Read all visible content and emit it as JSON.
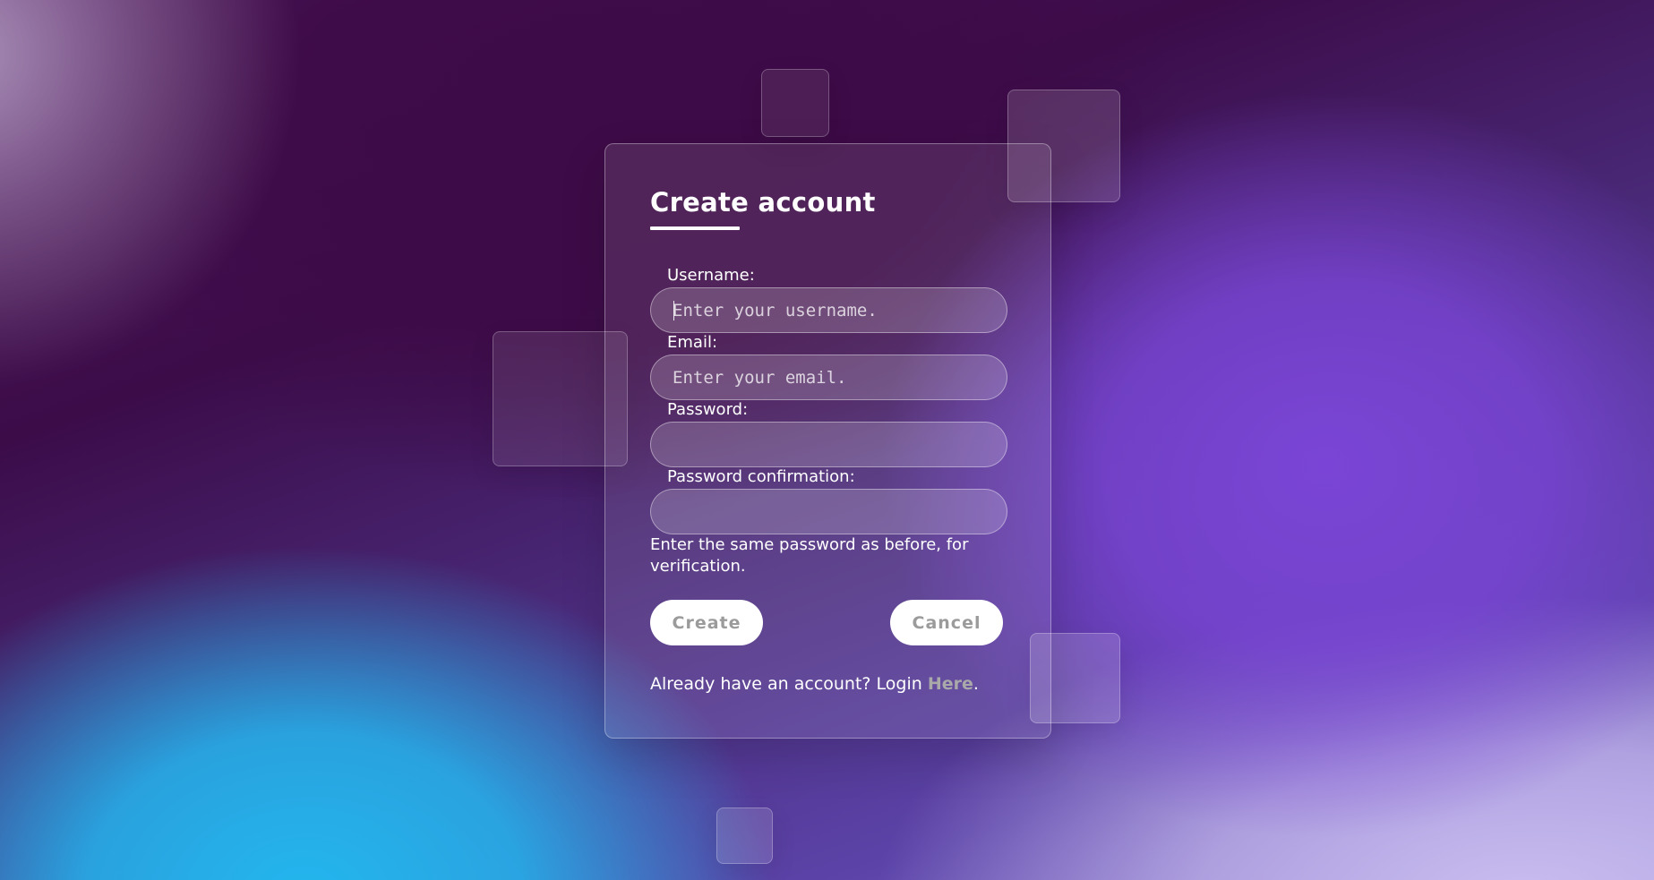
{
  "form": {
    "title": "Create account",
    "fields": [
      {
        "label": "Username:",
        "placeholder": "Enter your username.",
        "value": ""
      },
      {
        "label": "Email:",
        "placeholder": "Enter your email.",
        "value": ""
      },
      {
        "label": "Password:",
        "placeholder": "",
        "value": ""
      },
      {
        "label": "Password confirmation:",
        "placeholder": "",
        "value": ""
      }
    ],
    "help_text": "Enter the same password as before, for verification.",
    "create_label": "Create",
    "cancel_label": "Cancel",
    "login_prompt": "Already have an account? Login ",
    "login_link_label": "Here",
    "login_suffix": "."
  },
  "colors": {
    "text": "#ffffff",
    "button_background": "#ffffff",
    "button_text": "#9b9b9b",
    "link_text": "#a9a9a9",
    "background_purple": "#3c0c49",
    "background_blue": "#23b6ee",
    "background_violet": "#7a45d6"
  }
}
